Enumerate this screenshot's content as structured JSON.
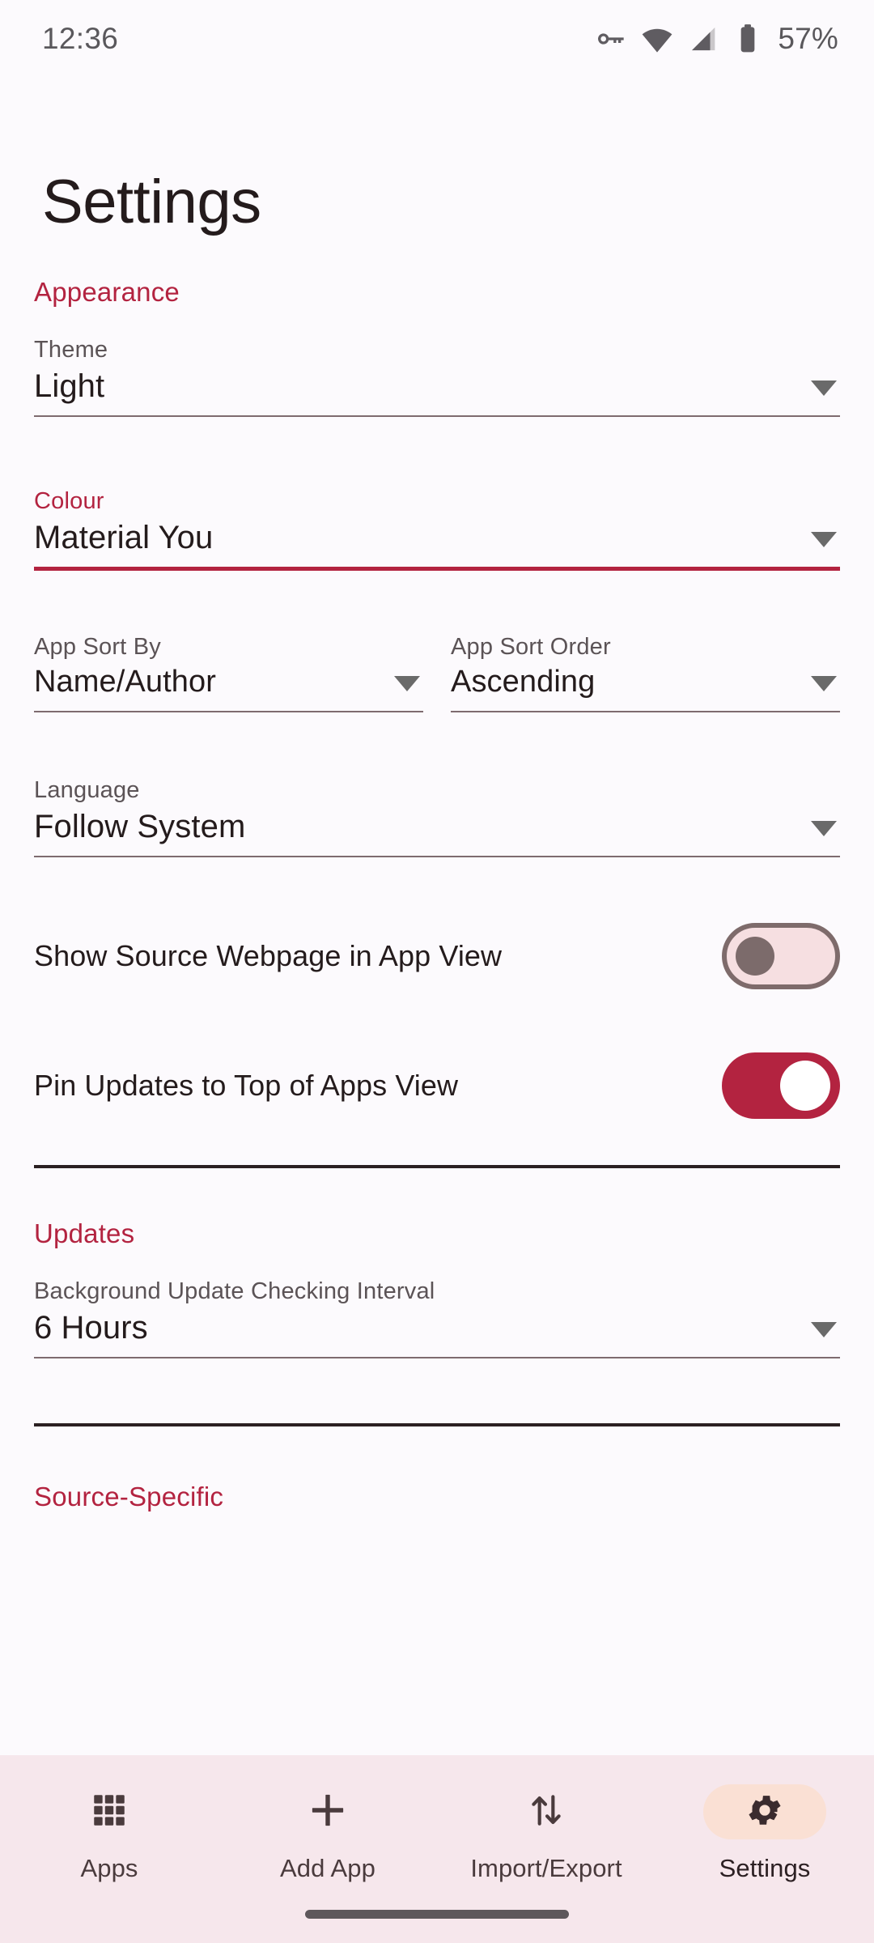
{
  "status_bar": {
    "time": "12:36",
    "battery_percent": "57%",
    "icons": [
      "vpn-key-icon",
      "wifi-icon",
      "cellular-signal-icon",
      "battery-icon"
    ]
  },
  "page": {
    "title": "Settings"
  },
  "theme_colors": {
    "accent": "#B32340",
    "background": "#FCFAFD",
    "on_background": "#241B1C",
    "label": "#5B5356",
    "underline": "#7E6B6F",
    "nav_background": "#F6E7EC",
    "nav_active_pill": "#FAE0D4",
    "switch_on_track": "#B32340",
    "switch_off_track": "#F6DFE1",
    "switch_off_border": "#7E6B6B"
  },
  "sections": {
    "appearance": {
      "header": "Appearance",
      "theme": {
        "label": "Theme",
        "value": "Light"
      },
      "colour": {
        "label": "Colour",
        "value": "Material You",
        "focused": true
      },
      "app_sort_by": {
        "label": "App Sort By",
        "value": "Name/Author"
      },
      "app_sort_order": {
        "label": "App Sort Order",
        "value": "Ascending"
      },
      "language": {
        "label": "Language",
        "value": "Follow System"
      },
      "show_source_webpage": {
        "label": "Show Source Webpage in App View",
        "state": "off"
      },
      "pin_updates": {
        "label": "Pin Updates to Top of Apps View",
        "state": "on"
      }
    },
    "updates": {
      "header": "Updates",
      "background_interval": {
        "label": "Background Update Checking Interval",
        "value": "6 Hours"
      }
    },
    "source_specific": {
      "header": "Source-Specific"
    }
  },
  "bottom_nav": {
    "items": [
      {
        "label": "Apps",
        "icon": "grid-apps-icon",
        "active": false
      },
      {
        "label": "Add App",
        "icon": "plus-icon",
        "active": false
      },
      {
        "label": "Import/Export",
        "icon": "import-export-arrows-icon",
        "active": false
      },
      {
        "label": "Settings",
        "icon": "gear-icon",
        "active": true
      }
    ]
  }
}
